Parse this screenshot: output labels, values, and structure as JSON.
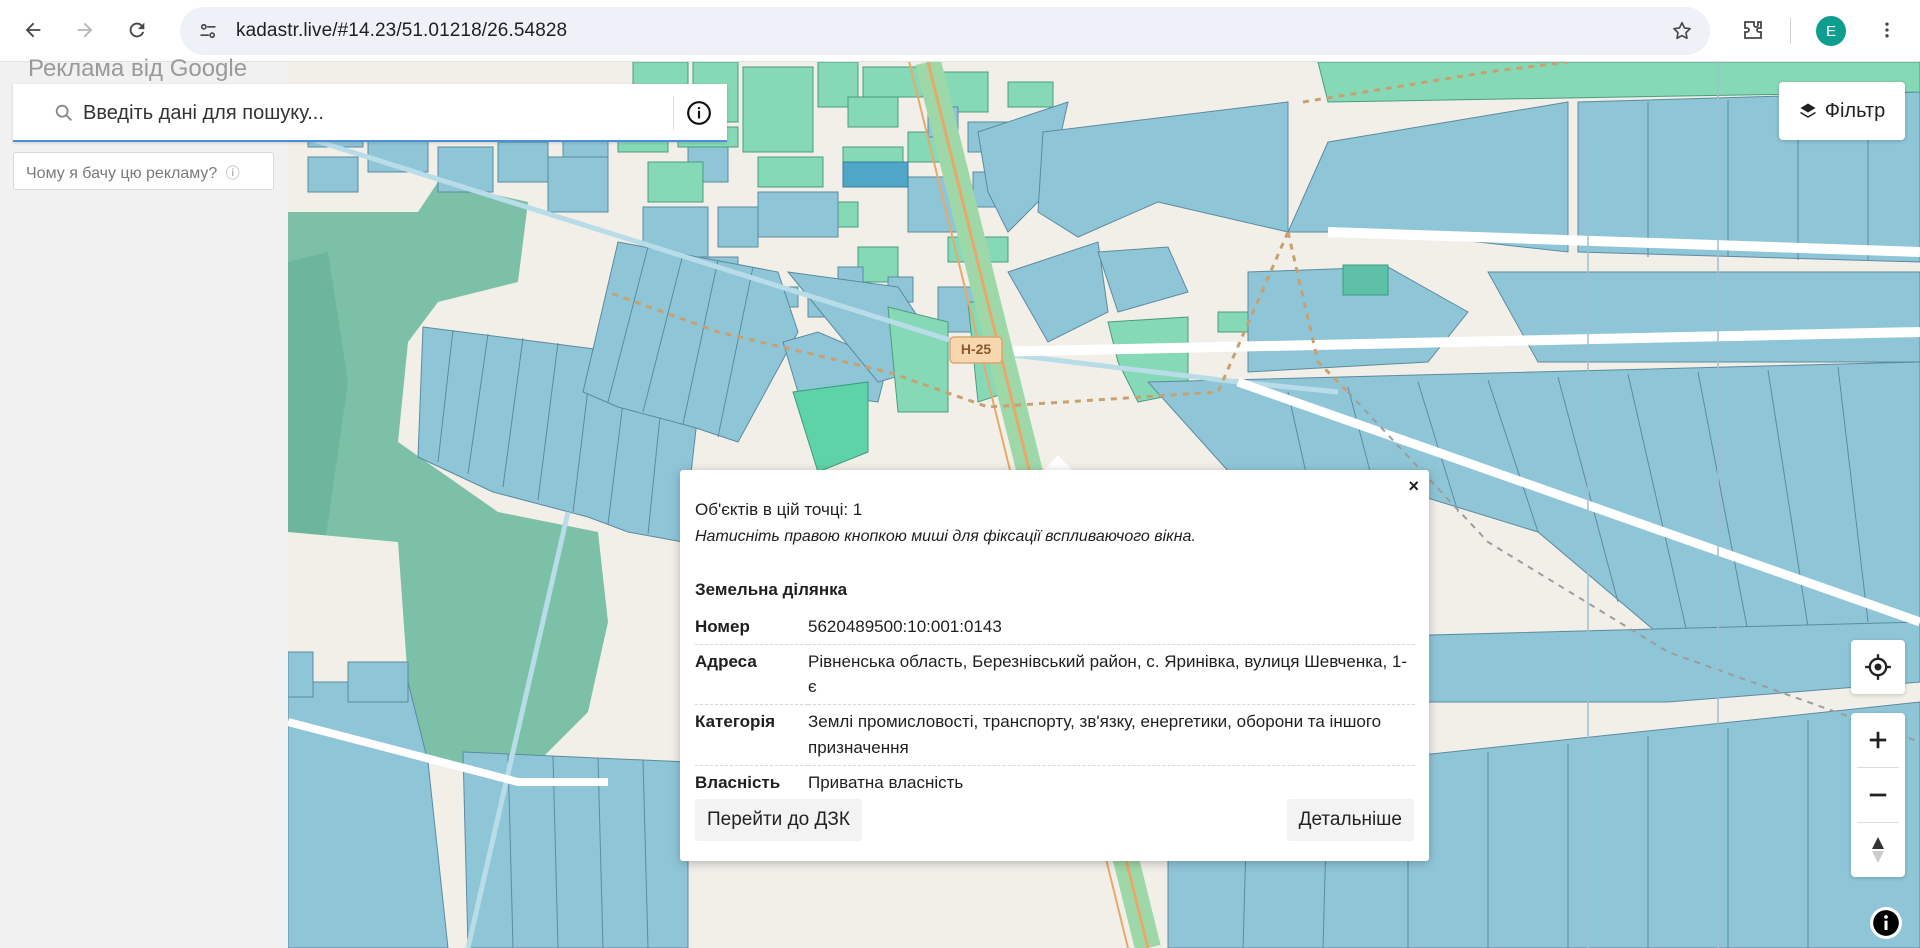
{
  "browser": {
    "url": "kadastr.live/#14.23/51.01218/26.54828",
    "profile_initial": "E"
  },
  "ad": {
    "header": "Реклама від Google",
    "why_text": "Чому я бачу цю рекламу?"
  },
  "search": {
    "placeholder": "Введіть дані для пошуку..."
  },
  "filter": {
    "label": "Фільтр"
  },
  "map": {
    "road_label": "H-25",
    "colors": {
      "parcel_blue": "#8ec6d8",
      "parcel_green": "#86d9b7",
      "parcel_teal": "#5fb3a0",
      "background": "#f2efe9",
      "road": "#e9a86b"
    }
  },
  "popup": {
    "close": "×",
    "count": "Об'єктів в цій точці: 1",
    "hint": "Натисніть правою кнопкою миші для фіксації вспливаючого вікна.",
    "title": "Земельна ділянка",
    "rows": [
      {
        "key": "Номер",
        "value": "5620489500:10:001:0143"
      },
      {
        "key": "Адреса",
        "value": "Рівненська область, Березнівський район, с. Яринівка, вулиця Шевченка, 1-є"
      },
      {
        "key": "Категорія",
        "value": "Землі промисловості, транспорту, зв'язку, енергетики, оборони та іншого призначення"
      },
      {
        "key": "Власність",
        "value": "Приватна власність"
      }
    ],
    "btn_dzk": "Перейти до ДЗК",
    "btn_details": "Детальніше"
  }
}
